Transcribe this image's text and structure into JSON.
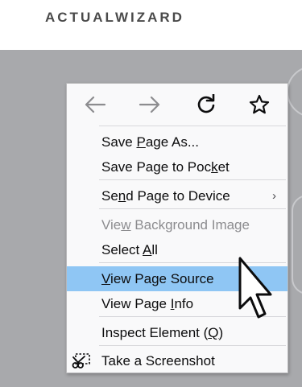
{
  "header": {
    "logo": "ACTUALWIZARD"
  },
  "nav": {
    "back_icon": "arrow-left-icon",
    "forward_icon": "arrow-right-icon",
    "reload_icon": "reload-icon",
    "bookmark_icon": "star-icon"
  },
  "menu": {
    "save_page_as": {
      "pre": "Save ",
      "key": "P",
      "post": "age As..."
    },
    "save_page_to_pocket": {
      "pre": "Save Page to Poc",
      "key": "k",
      "post": "et"
    },
    "send_page_to_device": {
      "pre": "Se",
      "key": "n",
      "post": "d Page to Device",
      "arrow": "›"
    },
    "view_background_image": {
      "pre": "Vie",
      "key": "w",
      "post": " Background Image"
    },
    "select_all": {
      "pre": "Select ",
      "key": "A",
      "post": "ll"
    },
    "view_page_source": {
      "pre": "",
      "key": "V",
      "post": "iew Page Source"
    },
    "view_page_info": {
      "pre": "View Page ",
      "key": "I",
      "post": "nfo"
    },
    "inspect_element": {
      "pre": "Inspect Element (",
      "key": "Q",
      "post": ")"
    },
    "take_screenshot": {
      "label": "Take a Screenshot",
      "icon": "scissors-icon"
    }
  },
  "colors": {
    "highlight": "#8fc6f4",
    "overlay": "#a8a9ac",
    "disabled": "#8c8c8f"
  }
}
